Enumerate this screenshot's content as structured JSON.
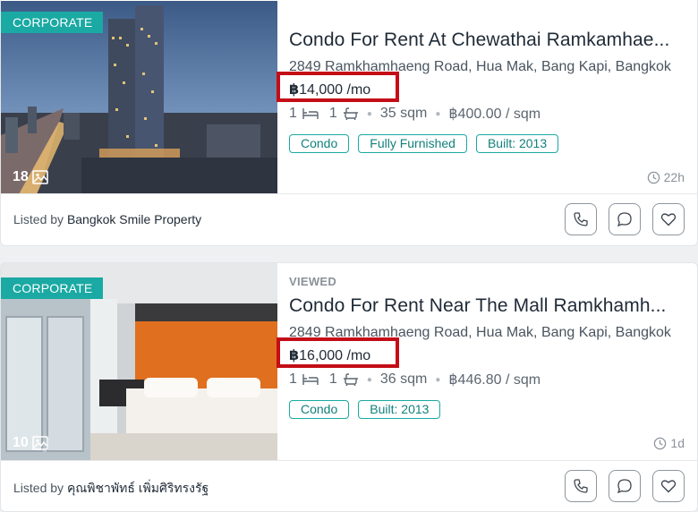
{
  "listings": [
    {
      "badge": "CORPORATE",
      "photo_count": "18",
      "viewed": "",
      "title": "Condo For Rent At Chewathai Ramkamhae...",
      "address": "2849 Ramkhamhaeng Road, Hua Mak, Bang Kapi, Bangkok",
      "price_currency": "฿",
      "price_value": "14,000 /mo",
      "beds": "1",
      "baths": "1",
      "area": "35 sqm",
      "price_per_sqm": "฿400.00 / sqm",
      "tags": [
        "Condo",
        "Fully Furnished",
        "Built: 2013"
      ],
      "time": "22h",
      "listed_by_prefix": "Listed by ",
      "agent": "Bangkok Smile Property"
    },
    {
      "badge": "CORPORATE",
      "photo_count": "10",
      "viewed": "VIEWED",
      "title": "Condo For Rent Near The Mall Ramkhamh...",
      "address": "2849 Ramkhamhaeng Road, Hua Mak, Bang Kapi, Bangkok",
      "price_currency": "฿",
      "price_value": "16,000 /mo",
      "beds": "1",
      "baths": "1",
      "area": "36 sqm",
      "price_per_sqm": "฿446.80 / sqm",
      "tags": [
        "Condo",
        "Built: 2013"
      ],
      "time": "1d",
      "listed_by_prefix": "Listed by ",
      "agent": "คุณพิชาพัทธ์ เพิ่มศิริทรงรัฐ"
    }
  ],
  "colors": {
    "accent": "#1aa9a3",
    "highlight": "#c40d16"
  },
  "icons": [
    "image-icon",
    "bed-icon",
    "bath-icon",
    "clock-icon",
    "phone-icon",
    "chat-icon",
    "heart-icon"
  ]
}
